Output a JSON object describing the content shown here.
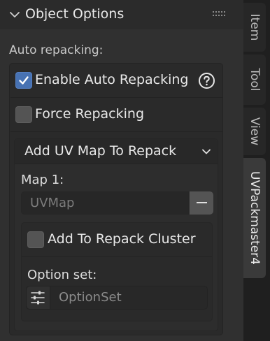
{
  "panel": {
    "title": "Object Options",
    "section_label": "Auto repacking:",
    "enable_auto_repacking": {
      "label": "Enable Auto Repacking",
      "checked": true
    },
    "force_repacking": {
      "label": "Force Repacking",
      "checked": false
    },
    "add_uv_map_dropdown": {
      "label": "Add UV Map To Repack"
    },
    "map_entry": {
      "label": "Map 1:",
      "value": "UVMap"
    },
    "add_to_cluster": {
      "label": "Add To Repack Cluster",
      "checked": false
    },
    "option_set": {
      "label": "Option set:",
      "placeholder": "OptionSet"
    }
  },
  "tabs": [
    {
      "label": "Item",
      "active": false
    },
    {
      "label": "Tool",
      "active": false
    },
    {
      "label": "View",
      "active": false
    },
    {
      "label": "UVPackmaster4",
      "active": true
    }
  ],
  "colors": {
    "accent": "#4772b3",
    "panel_bg": "#303030",
    "tab_strip_bg": "#1f1f1f"
  }
}
